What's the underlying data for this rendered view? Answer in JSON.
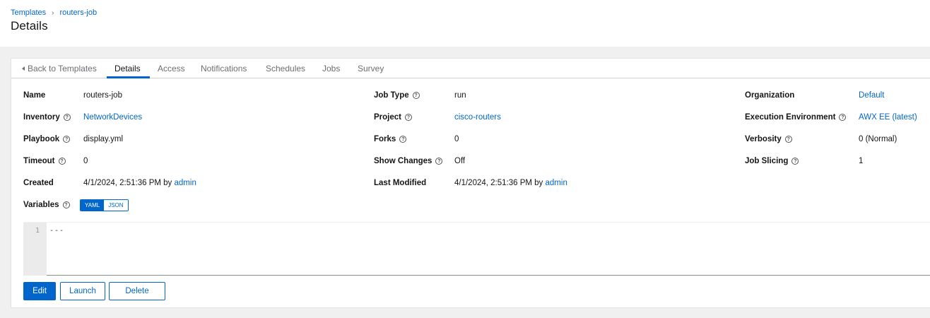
{
  "breadcrumb": {
    "templates": "Templates",
    "separator": "›",
    "current": "routers-job"
  },
  "page_title": "Details",
  "tabs": {
    "back": "Back to Templates",
    "details": "Details",
    "access": "Access",
    "notifications": "Notifications",
    "schedules": "Schedules",
    "jobs": "Jobs",
    "survey": "Survey"
  },
  "details": {
    "name": {
      "label": "Name",
      "value": "routers-job"
    },
    "job_type": {
      "label": "Job Type",
      "value": "run"
    },
    "organization": {
      "label": "Organization",
      "value": "Default"
    },
    "inventory": {
      "label": "Inventory",
      "value": "NetworkDevices"
    },
    "project": {
      "label": "Project",
      "value": "cisco-routers"
    },
    "execution_environment": {
      "label": "Execution Environment",
      "value": "AWX EE (latest)"
    },
    "playbook": {
      "label": "Playbook",
      "value": "display.yml"
    },
    "forks": {
      "label": "Forks",
      "value": "0"
    },
    "verbosity": {
      "label": "Verbosity",
      "value": "0 (Normal)"
    },
    "timeout": {
      "label": "Timeout",
      "value": "0"
    },
    "show_changes": {
      "label": "Show Changes",
      "value": "Off"
    },
    "job_slicing": {
      "label": "Job Slicing",
      "value": "1"
    },
    "created": {
      "label": "Created",
      "date": "4/1/2024, 2:51:36 PM by ",
      "user": "admin"
    },
    "last_modified": {
      "label": "Last Modified",
      "date": "4/1/2024, 2:51:36 PM by ",
      "user": "admin"
    },
    "variables": {
      "label": "Variables",
      "yaml": "YAML",
      "json": "JSON",
      "selected": "YAML"
    }
  },
  "help_icon_glyph": "?",
  "editor": {
    "line_number": "1",
    "content": "---"
  },
  "buttons": {
    "edit": "Edit",
    "launch": "Launch",
    "delete": "Delete"
  },
  "colors": {
    "accent": "#0066cc",
    "page_bg": "#f0f0f0",
    "text": "#151515",
    "muted": "#6a6e73"
  }
}
